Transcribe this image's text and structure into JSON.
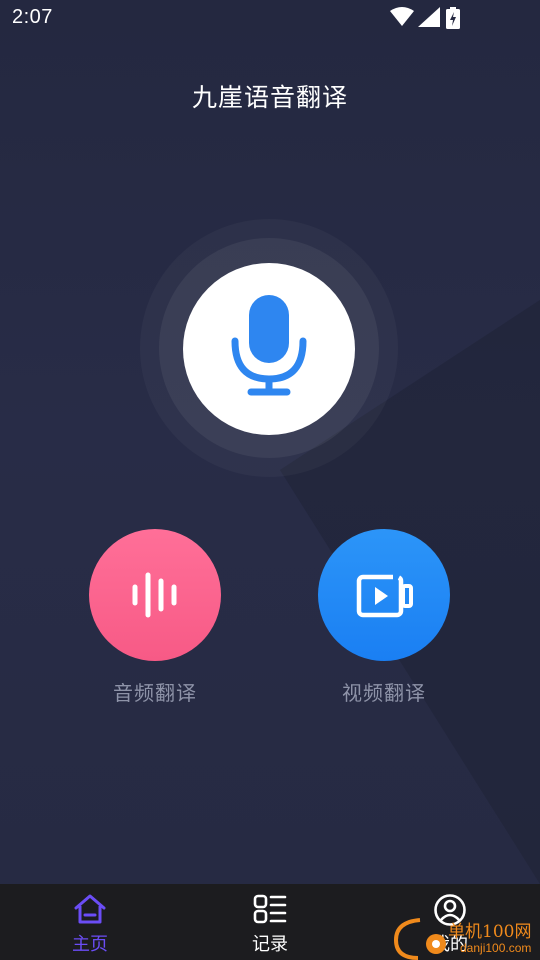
{
  "status_bar": {
    "time": "2:07",
    "icons": [
      "wifi-icon",
      "signal-icon",
      "battery-icon"
    ]
  },
  "app": {
    "title": "九崖语音翻译"
  },
  "main": {
    "mic_icon": "microphone-icon",
    "features": [
      {
        "label": "音频翻译",
        "icon": "audio-wave-icon",
        "color": "#f9628d"
      },
      {
        "label": "视频翻译",
        "icon": "video-play-icon",
        "color": "#2189f6"
      }
    ]
  },
  "bottom_nav": {
    "items": [
      {
        "label": "主页",
        "icon": "home-icon",
        "active": true
      },
      {
        "label": "记录",
        "icon": "records-list-icon",
        "active": false
      },
      {
        "label": "我的",
        "icon": "user-icon",
        "active": false
      }
    ],
    "active_color": "#6b4df6"
  },
  "watermark": {
    "line1": "单机100网",
    "line2": "danji100.com"
  },
  "colors": {
    "background": "#262a42",
    "mic_blue": "#2e86f0",
    "nav_background": "#1c1c1f"
  }
}
